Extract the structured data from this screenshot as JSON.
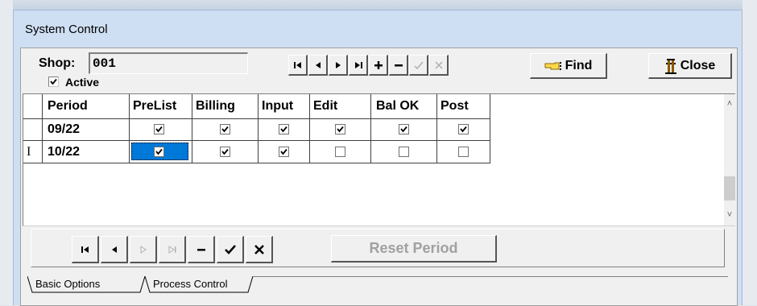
{
  "window": {
    "title": "System Control"
  },
  "shop": {
    "label": "Shop:",
    "value": "001",
    "active_label": "Active",
    "active_checked": true
  },
  "toolbar": {
    "find_label": "Find",
    "close_label": "Close"
  },
  "grid": {
    "columns": [
      "Period",
      "PreList",
      "Billing",
      "Input",
      "Edit",
      "Bal OK",
      "Post"
    ],
    "rows": [
      {
        "period": "09/22",
        "checks": [
          true,
          true,
          true,
          true,
          true,
          true
        ],
        "current": false
      },
      {
        "period": "10/22",
        "checks": [
          true,
          true,
          true,
          false,
          false,
          false
        ],
        "current": true
      }
    ],
    "row_indicator": "I"
  },
  "bottom": {
    "reset_label": "Reset Period"
  },
  "tabs": [
    "Basic Options",
    "Process Control"
  ],
  "colors": {
    "selection": "#0078d7",
    "accent_bg": "#cfdff3"
  }
}
